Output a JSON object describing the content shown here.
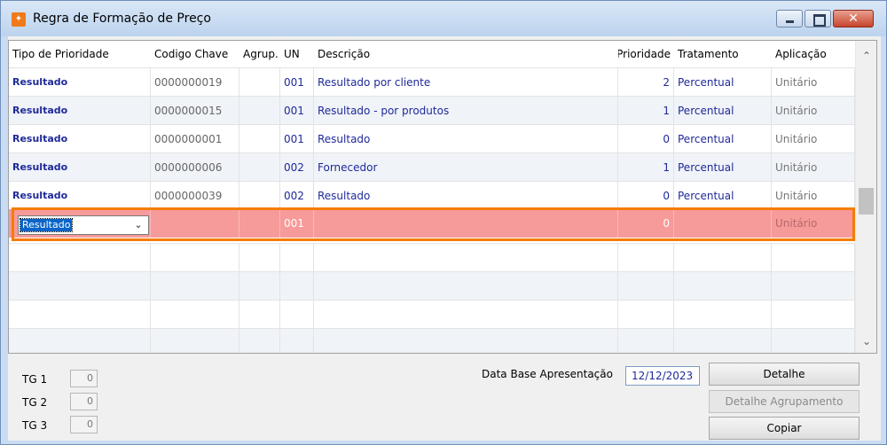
{
  "window": {
    "title": "Regra de Formação de Preço",
    "app_icon_glyph": "✦"
  },
  "grid": {
    "headers": {
      "tipo": "Tipo de Prioridade",
      "codigo": "Codigo Chave",
      "agrup": "Agrup.",
      "un": "UN",
      "descricao": "Descrição",
      "prioridade": "Prioridade",
      "tratamento": "Tratamento",
      "aplicacao": "Aplicação"
    },
    "rows": [
      {
        "tipo": "Resultado",
        "codigo": "0000000019",
        "agrup": "",
        "un": "001",
        "descricao": "Resultado por cliente",
        "prioridade": "2",
        "tratamento": "Percentual",
        "aplicacao": "Unitário"
      },
      {
        "tipo": "Resultado",
        "codigo": "0000000015",
        "agrup": "",
        "un": "001",
        "descricao": "Resultado - por produtos",
        "prioridade": "1",
        "tratamento": "Percentual",
        "aplicacao": "Unitário"
      },
      {
        "tipo": "Resultado",
        "codigo": "0000000001",
        "agrup": "",
        "un": "001",
        "descricao": "Resultado",
        "prioridade": "0",
        "tratamento": "Percentual",
        "aplicacao": "Unitário"
      },
      {
        "tipo": "Resultado",
        "codigo": "0000000006",
        "agrup": "",
        "un": "002",
        "descricao": "Fornecedor",
        "prioridade": "1",
        "tratamento": "Percentual",
        "aplicacao": "Unitário"
      },
      {
        "tipo": "Resultado",
        "codigo": "0000000039",
        "agrup": "",
        "un": "002",
        "descricao": "Resultado",
        "prioridade": "0",
        "tratamento": "Percentual",
        "aplicacao": "Unitário"
      }
    ],
    "active_row": {
      "tipo": "Resultado",
      "codigo": "",
      "agrup": "",
      "un": "001",
      "descricao": "",
      "prioridade": "0",
      "tratamento": "",
      "aplicacao": "Unitário"
    },
    "scroll_up_glyph": "⌃",
    "scroll_down_glyph": "⌄",
    "combo_arrow_glyph": "⌄"
  },
  "footer": {
    "tg1_label": "TG 1",
    "tg1_value": "0",
    "tg2_label": "TG 2",
    "tg2_value": "0",
    "tg3_label": "TG 3",
    "tg3_value": "0",
    "date_label": "Data Base Apresentação",
    "date_value": "12/12/2023",
    "btn_detalhe": "Detalhe",
    "btn_detalhe_agrupamento": "Detalhe Agrupamento",
    "btn_copiar": "Copiar"
  },
  "colors": {
    "active_row_bg": "#f79a9a",
    "highlight_border": "#f57c00",
    "text_blue": "#1f2a99"
  }
}
